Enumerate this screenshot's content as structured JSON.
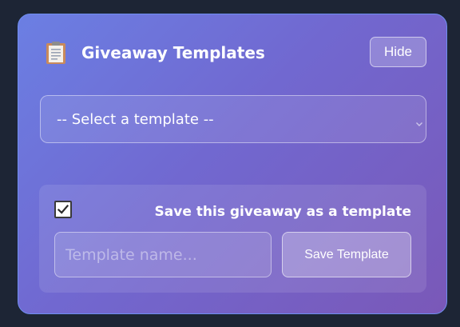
{
  "panel": {
    "title": "Giveaway Templates",
    "hide_label": "Hide",
    "icon": "clipboard-icon"
  },
  "template_select": {
    "selected": "-- Select a template --",
    "icon": "chevron-down-icon"
  },
  "save_section": {
    "checkbox_checked": true,
    "label": "Save this giveaway as a template",
    "input_placeholder": "Template name...",
    "input_value": "",
    "save_label": "Save Template"
  },
  "colors": {
    "background": "#1d2535",
    "panel_border": "#6f8ef0",
    "gradient_start": "#6b7fe3",
    "gradient_end": "#7a58b8"
  }
}
